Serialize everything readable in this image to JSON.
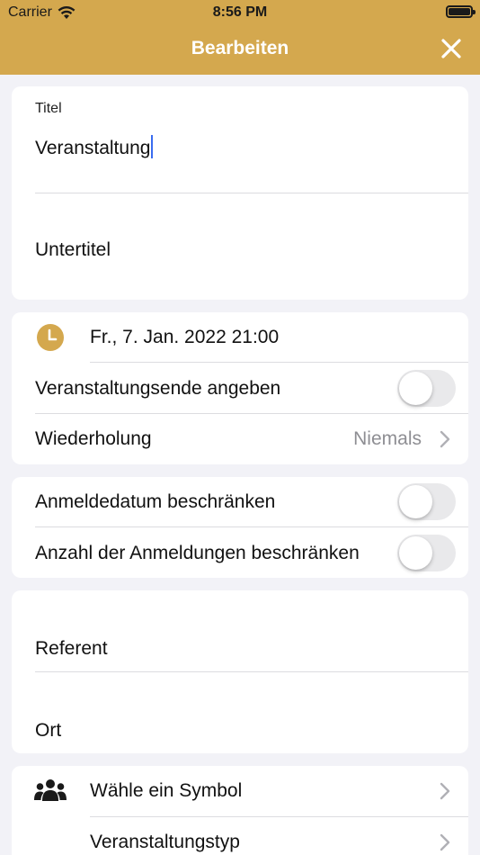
{
  "status": {
    "carrier": "Carrier",
    "time": "8:56 PM"
  },
  "nav": {
    "title": "Bearbeiten"
  },
  "title_section": {
    "title_label": "Titel",
    "title_value": "Veranstaltung",
    "subtitle_placeholder": "Untertitel"
  },
  "date_section": {
    "start_date": "Fr., 7. Jan. 2022 21:00",
    "end_label": "Veranstaltungsende angeben",
    "end_enabled": false,
    "repeat_label": "Wiederholung",
    "repeat_value": "Niemals"
  },
  "registration_section": {
    "limit_date_label": "Anmeldedatum beschränken",
    "limit_date_enabled": false,
    "limit_count_label": "Anzahl der Anmeldungen beschränken",
    "limit_count_enabled": false
  },
  "details_section": {
    "speaker_placeholder": "Referent",
    "location_placeholder": "Ort"
  },
  "symbol_section": {
    "symbol_label": "Wähle ein Symbol",
    "type_label": "Veranstaltungstyp"
  },
  "colors": {
    "accent": "#d4a84e",
    "background": "#f2f2f7",
    "secondary_text": "#8e8e93",
    "cursor": "#3a6cf0"
  },
  "icons": {
    "clock": "clock-icon",
    "group": "people-group-icon",
    "close": "close-icon",
    "chevron": "chevron-right-icon"
  }
}
